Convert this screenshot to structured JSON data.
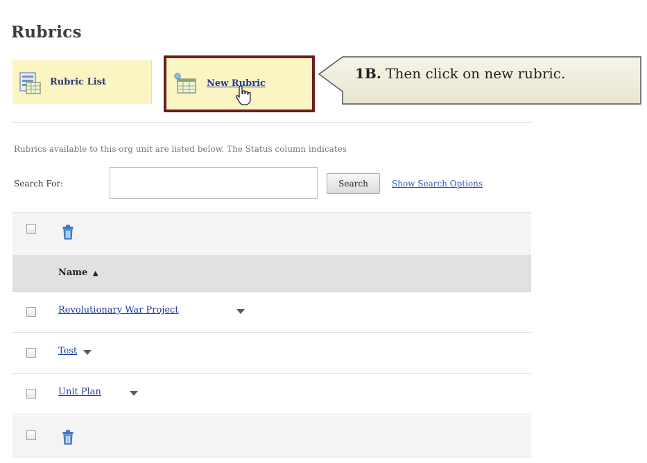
{
  "page": {
    "title": "Rubrics"
  },
  "tabs": {
    "rubric_list": "Rubric List",
    "new_rubric": "New Rubric"
  },
  "callout": {
    "step": "1B.",
    "text": "Then click on new rubric."
  },
  "description": "Rubrics available to this org unit are listed below. The Status column indicates",
  "search": {
    "label": "Search For:",
    "value": "",
    "button": "Search",
    "options_link": "Show Search Options"
  },
  "table": {
    "column_name": "Name",
    "sort_indicator": "▲",
    "rows": [
      {
        "name": "Revolutionary War Project"
      },
      {
        "name": "Test"
      },
      {
        "name": "Unit Plan"
      }
    ]
  },
  "icons": {
    "trash": "trash-icon",
    "rubric_list": "rubric-list-icon",
    "new_rubric": "new-rubric-icon",
    "cursor": "hand-cursor-icon",
    "context_menu": "chevron-down-icon"
  },
  "colors": {
    "tab_bg": "#fbf4c3",
    "highlight_border": "#6b1e1e",
    "link": "#1a3aa0",
    "callout_bg": "#f3f1e3"
  }
}
